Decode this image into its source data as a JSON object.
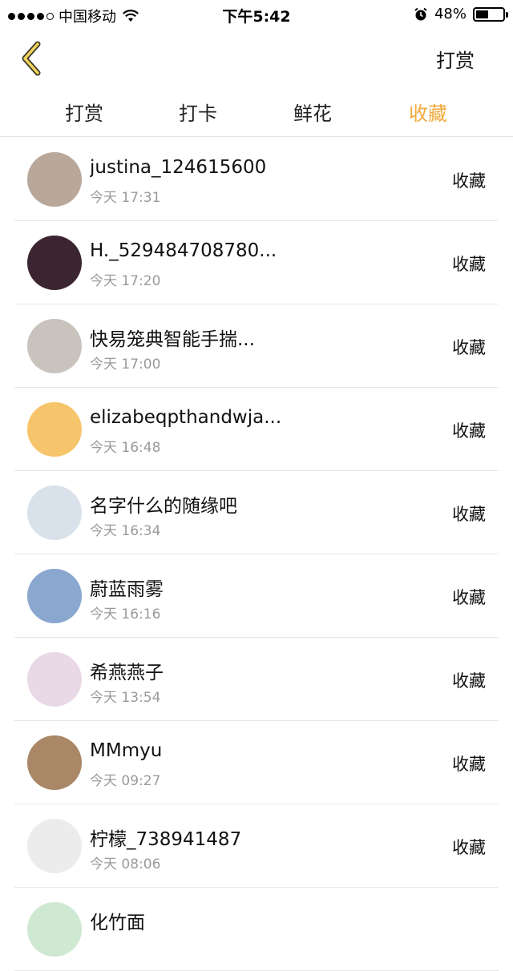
{
  "status_bar": {
    "carrier": "中国移动",
    "time": "下午5:42",
    "battery_percent": "48%",
    "battery_level": 0.48
  },
  "nav": {
    "action_label": "打赏"
  },
  "tabs": [
    {
      "label": "打赏",
      "active": false
    },
    {
      "label": "打卡",
      "active": false
    },
    {
      "label": "鲜花",
      "active": false
    },
    {
      "label": "收藏",
      "active": true
    }
  ],
  "colors": {
    "accent": "#f2a93b"
  },
  "list": [
    {
      "name": "justina_124615600",
      "time": "今天 17:31",
      "action": "收藏",
      "avatar_color": "#b9a79a"
    },
    {
      "name": "H._529484708780...",
      "time": "今天 17:20",
      "action": "收藏",
      "avatar_color": "#3b2530"
    },
    {
      "name": "快易笼典智能手揣...",
      "time": "今天 17:00",
      "action": "收藏",
      "avatar_color": "#c9c3bd"
    },
    {
      "name": "elizabeqpthandwja...",
      "time": "今天 16:48",
      "action": "收藏",
      "avatar_color": "#f6c46a"
    },
    {
      "name": "名字什么的随缘吧",
      "time": "今天 16:34",
      "action": "收藏",
      "avatar_color": "#d9e1ea"
    },
    {
      "name": "蔚蓝雨雾",
      "time": "今天 16:16",
      "action": "收藏",
      "avatar_color": "#8aa7cf"
    },
    {
      "name": "希燕燕子",
      "time": "今天 13:54",
      "action": "收藏",
      "avatar_color": "#e9d9e6"
    },
    {
      "name": "MMmyu",
      "time": "今天 09:27",
      "action": "收藏",
      "avatar_color": "#a98767"
    },
    {
      "name": "柠檬_738941487",
      "time": "今天 08:06",
      "action": "收藏",
      "avatar_color": "#ececec"
    },
    {
      "name": "化竹面",
      "time": "",
      "action": "",
      "avatar_color": "#cfe8d2"
    }
  ]
}
